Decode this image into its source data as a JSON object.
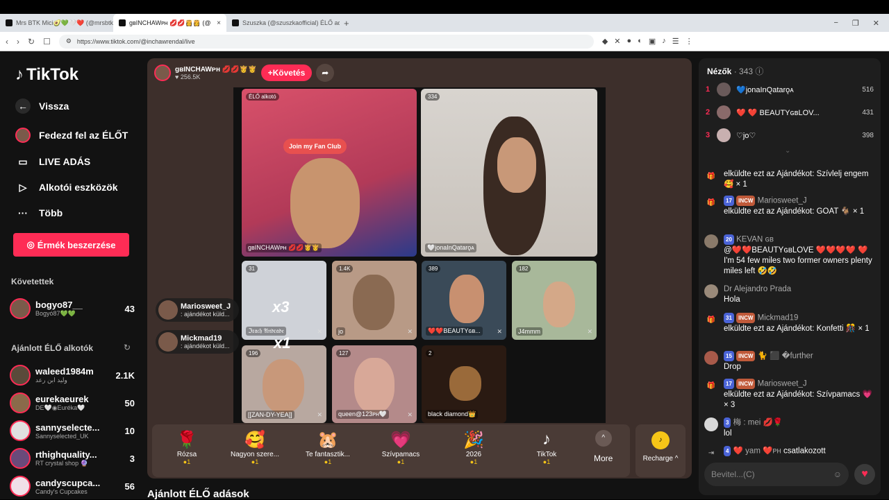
{
  "browser": {
    "tabs": [
      {
        "title": "Mrs BTK Mici🥑💚🤍❤️ (@mrsbtk)"
      },
      {
        "title": "gʙINCHAWᴘʜ 💋💋👸👸 (@"
      },
      {
        "title": "Szuszka (@szuszkaofficial) ÉLŐ adás"
      }
    ],
    "url": "https://www.tiktok.com/@inchawrendal/live"
  },
  "sidebar": {
    "logo": "TikTok",
    "back": "Vissza",
    "nav": [
      {
        "label": "Fedezd fel az ÉLŐT",
        "icon": "avatar-icon"
      },
      {
        "label": "LIVE ADÁS",
        "icon": "camera-icon"
      },
      {
        "label": "Alkotói eszközök",
        "icon": "creator-tools-icon"
      },
      {
        "label": "Több",
        "icon": "more-icon"
      }
    ],
    "coins_button": "Érmék beszerzése",
    "following_title": "Követettek",
    "following": [
      {
        "name": "bogyo87__",
        "sub": "Bogyó87💚💚",
        "count": "43"
      }
    ],
    "recommended_title": "Ajánlott ÉLŐ alkotók",
    "recommended": [
      {
        "name": "waleed1984m",
        "sub": "وليد ابن رعد",
        "count": "2.1K"
      },
      {
        "name": "eurekaeurek",
        "sub": "DE🤍◉Euréka🤍",
        "count": "50"
      },
      {
        "name": "sannyselecte...",
        "sub": "Sannyselected_UK",
        "count": "10"
      },
      {
        "name": "rthighquality...",
        "sub": "RT crystal shop 🔮",
        "count": "3"
      },
      {
        "name": "candyscupca...",
        "sub": "Candy's Cupcakes",
        "count": "56"
      }
    ]
  },
  "stage": {
    "host_name": "gʙINCHAWᴘʜ 💋💋👸👸",
    "host_likes": "♥ 256.5K",
    "follow_label": "+Követés",
    "main_cells": [
      {
        "badge": "ÉLŐ alkotó",
        "name": "gʙINCHAWᴘʜ 💋💋👸👸",
        "fanclub": "Join my Fan Club"
      },
      {
        "badge": "334",
        "name": "🤍jonaInQatarǫᴀ"
      }
    ],
    "grid_cells": [
      {
        "badge": "31",
        "name": "ℑ𝔯𝔞𝔠𝔥 𝔄𝔫𝔡𝔯𝔞𝔡𝔢"
      },
      {
        "badge": "1.4K",
        "name": "jo"
      },
      {
        "badge": "389",
        "name": "❤️❤️BEAUTYɢʙ..."
      },
      {
        "badge": "182",
        "name": "J4mmm"
      },
      {
        "badge": "196",
        "name": "[[ZAN-DY-YEA]]"
      },
      {
        "badge": "127",
        "name": "queen@123ᴘʜ🤍"
      },
      {
        "badge": "2",
        "name": "black diamond👑"
      }
    ],
    "gift_popups": [
      {
        "name": "Mariosweet_J",
        "sub": ": ajándékot küld...",
        "count": "x3"
      },
      {
        "name": "Mickmad19",
        "sub": ": ajándékot küld...",
        "count": "x1"
      }
    ],
    "gifts": [
      {
        "name": "Rózsa",
        "price": "1",
        "icon": "🌹"
      },
      {
        "name": "Nagyon szere...",
        "price": "1",
        "icon": "🥰"
      },
      {
        "name": "Te fantasztik...",
        "price": "1",
        "icon": "🐹"
      },
      {
        "name": "Szívpamacs",
        "price": "1",
        "icon": "💗"
      },
      {
        "name": "2026",
        "price": "1",
        "icon": "🎉"
      },
      {
        "name": "TikTok",
        "price": "1",
        "icon": "♪"
      }
    ],
    "more_label": "More",
    "recharge_label": "Recharge ^"
  },
  "recommended_heading": "Ajánlott ÉLŐ adások",
  "right": {
    "viewers_label": "Nézők",
    "viewers_count": "· 343",
    "top_viewers": [
      {
        "rank": "1",
        "name": "💙jonaInQatarǫᴀ",
        "score": "516"
      },
      {
        "rank": "2",
        "name": "❤️ ❤️ BEAUTYɢʙLOV...",
        "score": "431"
      },
      {
        "rank": "3",
        "name": "♡jo♡",
        "score": "398"
      }
    ],
    "messages": [
      {
        "text": "elküldte ezt az Ajándékot: Szívlelj engem 🥰 × 1",
        "icon": "gift"
      },
      {
        "user": "Mariosweet_J",
        "lvl": "17",
        "club": "INCW",
        "text": "elküldte ezt az Ajándékot: GOAT 🐐 × 1",
        "icon": "gift"
      },
      {
        "user": "KEVAN ɢʙ",
        "lvl": "20",
        "club": "",
        "text": "@❤️❤️BEAUTYɢʙLOVE ❤️❤️❤️❤️ ❤️ I'm 54 few miles two former owners plenty miles left 🤣🤣",
        "icon": "avatar"
      },
      {
        "user": "Dr Alejandro Prada",
        "lvl": "",
        "club": "",
        "text": "Hola",
        "icon": "avatar"
      },
      {
        "user": "Mickmad19",
        "lvl": "31",
        "club": "INCW",
        "text": "elküldte ezt az Ajándékot: Konfetti 🎊 × 1",
        "icon": "gift"
      },
      {
        "user": "🐈 ⬛ �further",
        "lvl": "15",
        "club": "INCW",
        "text": "Drop",
        "icon": "avatar"
      },
      {
        "user": "Mariosweet_J",
        "lvl": "17",
        "club": "INCW",
        "text": "elküldte ezt az Ajándékot: Szívpamacs 💗 × 3",
        "icon": "gift"
      },
      {
        "user": "梅 : mei 💋🌹",
        "lvl": "3",
        "club": "",
        "text": "lol",
        "icon": "avatar"
      },
      {
        "user": "❤️ yam ❤️ᴘʜ",
        "lvl": "4",
        "club": "",
        "text": "csatlakozott",
        "icon": "join"
      }
    ],
    "input_placeholder": "Bevitel...(C)"
  }
}
